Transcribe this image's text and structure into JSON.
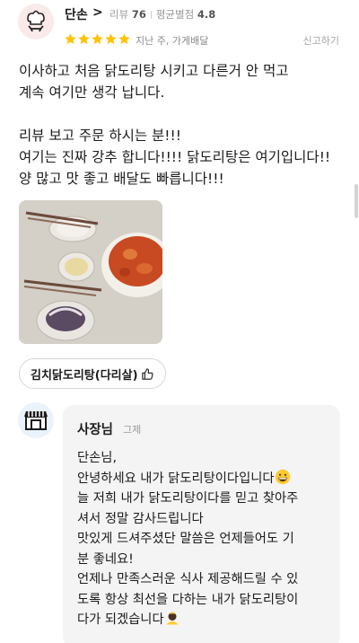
{
  "reviewer": {
    "nickname": "단손",
    "chevron": ">",
    "review_label": "리뷰",
    "review_count": "76",
    "rating_label": "평균별점",
    "avg_rating": "4.8",
    "stars": 5,
    "when": "지난 주, 가게배달",
    "report": "신고하기"
  },
  "review": {
    "lines_1": [
      "이사하고 처음 닭도리탕 시키고 다른거 안 먹고",
      "계속 여기만 생각 납니다."
    ],
    "lines_2": [
      "리뷰 보고 주문 하시는 분!!!",
      "여기는 진짜 강추 합니다!!!! 닭도리탕은 여기입니다!!",
      "양 많고 맛 좋고 배달도 빠릅니다!!!"
    ]
  },
  "menu_tag": "김치닭도리탕(다리살)",
  "owner": {
    "name": "사장님",
    "date": "그제",
    "lines": [
      "단손님,",
      "안녕하세요 내가 닭도리탕이다입니다",
      "늘 저희 내가 닭도리탕이다를 믿고 찾아주",
      "셔서 정말 감사드립니다",
      "맛있게 드셔주셨단 말씀은 언제들어도 기",
      "분 좋네요!",
      "언제나 만족스러운 식사 제공해드릴 수 있",
      "도록 항상 최선을 다하는 내가 닭도리탕이",
      "다가 되겠습니다"
    ]
  },
  "colors": {
    "star": "#ffc200",
    "text": "#1b1b1b",
    "muted": "#9a9a9a",
    "bubble": "#f4f4f4"
  }
}
